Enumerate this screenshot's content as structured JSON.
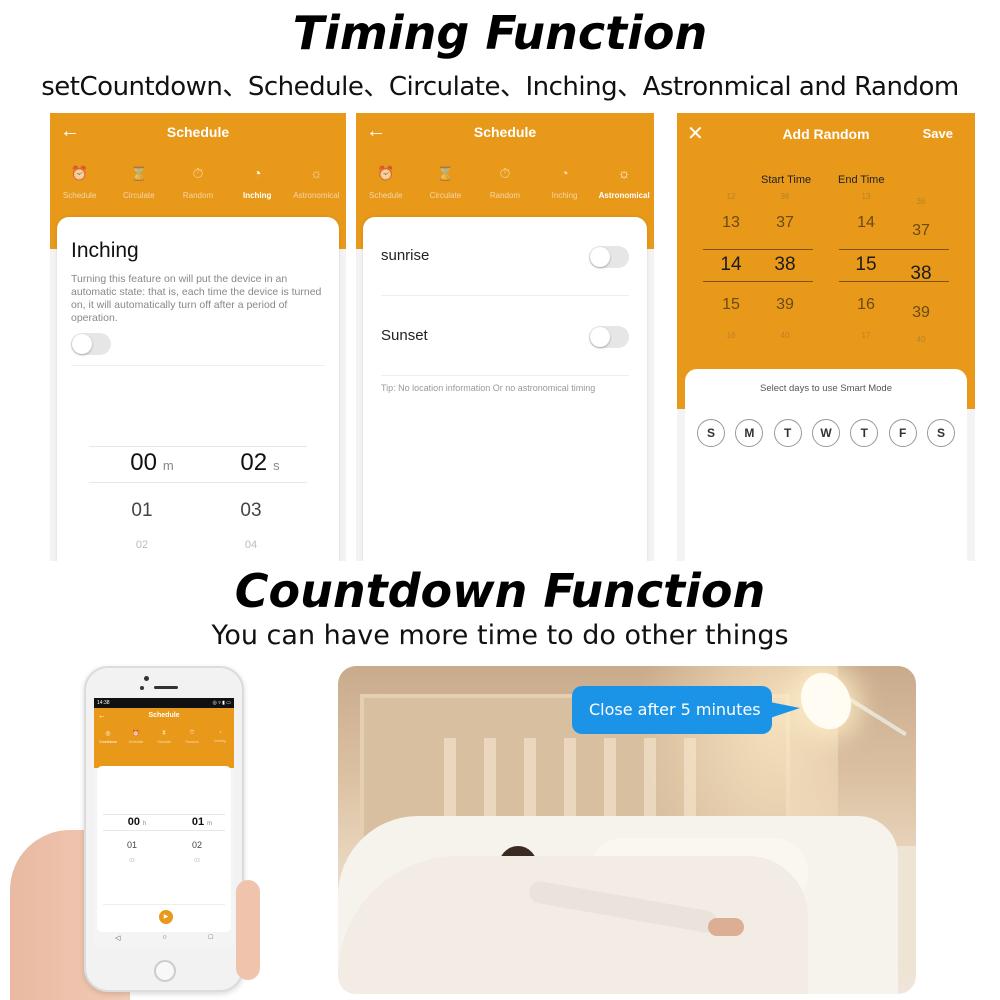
{
  "header": {
    "title": "Timing Function",
    "subtitle": "setCountdown、Schedule、Circulate、Inching、Astronmical and Random"
  },
  "colors": {
    "accent": "#e8991a",
    "bubble": "#1b94e8"
  },
  "panel_inching": {
    "title": "Schedule",
    "back_icon": "arrow-left-icon",
    "tabs": [
      {
        "label": "Schedule",
        "icon": "alarm-clock-icon",
        "active": false
      },
      {
        "label": "Circulate",
        "icon": "hourglass-icon",
        "active": false
      },
      {
        "label": "Random",
        "icon": "stopwatch-icon",
        "active": false
      },
      {
        "label": "Inching",
        "icon": "clock-icon",
        "active": true
      },
      {
        "label": "Astronomical",
        "icon": "sun-horizon-icon",
        "active": false
      }
    ],
    "heading": "Inching",
    "description": "Turning this feature on will put the device in an automatic state: that is, each time the device is turned on, it will automatically turn off after a period of operation.",
    "toggle_on": false,
    "picker": {
      "minutes": {
        "selected": "00",
        "next": "01",
        "next2": "02",
        "unit": "m"
      },
      "seconds": {
        "selected": "02",
        "next": "03",
        "next2": "04",
        "unit": "s"
      }
    }
  },
  "panel_astronomical": {
    "title": "Schedule",
    "back_icon": "arrow-left-icon",
    "tabs": [
      {
        "label": "Schedule",
        "icon": "alarm-clock-icon",
        "active": false
      },
      {
        "label": "Circulate",
        "icon": "hourglass-icon",
        "active": false
      },
      {
        "label": "Random",
        "icon": "stopwatch-icon",
        "active": false
      },
      {
        "label": "Inching",
        "icon": "clock-icon",
        "active": false
      },
      {
        "label": "Astronomical",
        "icon": "sun-horizon-icon",
        "active": true
      }
    ],
    "rows": [
      {
        "label": "sunrise",
        "on": false
      },
      {
        "label": "Sunset",
        "on": false
      }
    ],
    "tip": "Tip: No location information Or no astronomical timing"
  },
  "panel_random": {
    "title": "Add Random",
    "close_icon": "close-icon",
    "save_label": "Save",
    "start_label": "Start Time",
    "end_label": "End Time",
    "start": {
      "hours": [
        "12",
        "13",
        "14",
        "15",
        "16"
      ],
      "minutes": [
        "36",
        "37",
        "38",
        "39",
        "40"
      ]
    },
    "end": {
      "hours": [
        "13",
        "14",
        "15",
        "16",
        "17"
      ],
      "minutes": [
        "36",
        "37",
        "38",
        "39",
        "40"
      ]
    },
    "days_hint": "Select days to use Smart Mode",
    "days": [
      "S",
      "M",
      "T",
      "W",
      "T",
      "F",
      "S"
    ]
  },
  "countdown": {
    "title": "Countdown Function",
    "subtitle": "You can have more time to do other things"
  },
  "phone": {
    "status_time": "14:38",
    "status_icons": "◎ ▿ ▮ ▭",
    "title": "Schedule",
    "tabs": [
      {
        "label": "Countdown",
        "icon": "◎",
        "active": true
      },
      {
        "label": "Schedule",
        "icon": "⏰",
        "active": false
      },
      {
        "label": "Circulate",
        "icon": "⧗",
        "active": false
      },
      {
        "label": "Random",
        "icon": "⏱",
        "active": false
      },
      {
        "label": "Inching",
        "icon": "◔",
        "active": false
      }
    ],
    "picker": {
      "hours": {
        "selected": "00",
        "next": "01",
        "next2": "02",
        "unit": "h"
      },
      "minutes": {
        "selected": "01",
        "next": "02",
        "next2": "03",
        "unit": "m"
      }
    },
    "play_icon": "▶",
    "nav": [
      "◁",
      "○",
      "□"
    ]
  },
  "photo": {
    "bubble_text": "Close after 5 minutes"
  }
}
